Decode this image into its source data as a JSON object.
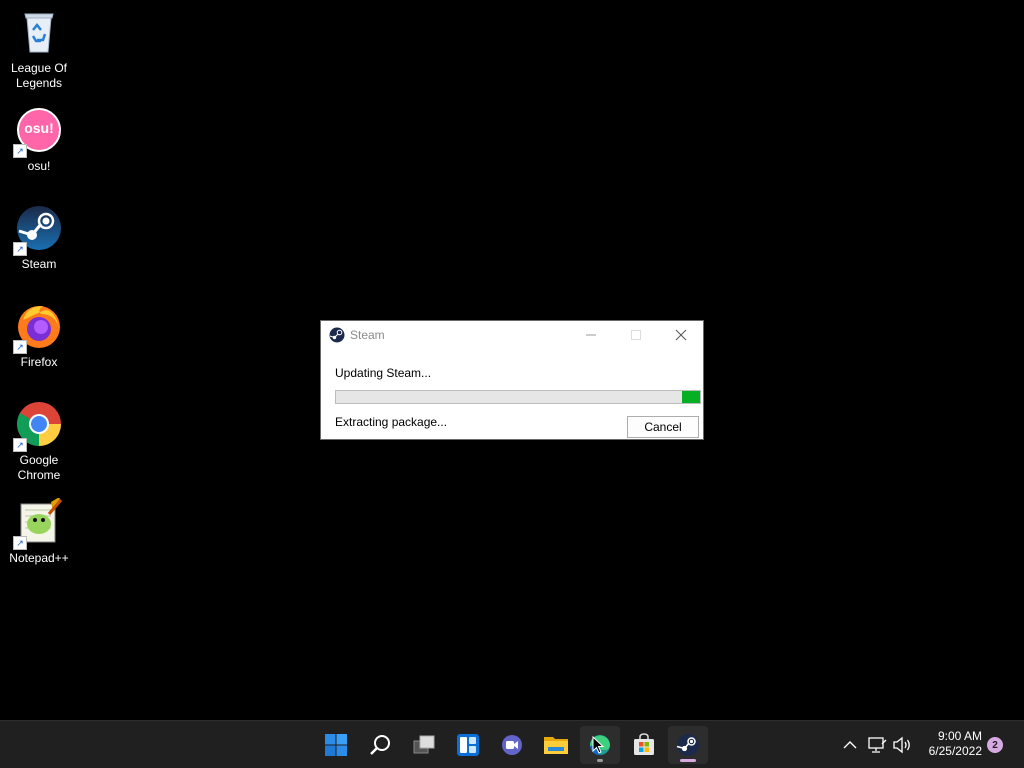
{
  "desktop": {
    "icons": [
      {
        "label": "League Of\nLegends",
        "icon": "recycle-bin-icon",
        "shortcut": false
      },
      {
        "label": "osu!",
        "icon": "osu-icon",
        "shortcut": true,
        "badge_text": "osu!"
      },
      {
        "label": "Steam",
        "icon": "steam-icon",
        "shortcut": true
      },
      {
        "label": "Firefox",
        "icon": "firefox-icon",
        "shortcut": true
      },
      {
        "label": "Google\nChrome",
        "icon": "chrome-icon",
        "shortcut": true
      },
      {
        "label": "Notepad++",
        "icon": "notepadpp-icon",
        "shortcut": true
      }
    ]
  },
  "dialog": {
    "title": "Steam",
    "status": "Updating Steam...",
    "substatus": "Extracting package...",
    "progress_fraction": 0.05,
    "cancel_label": "Cancel",
    "colors": {
      "progress": "#06b025"
    }
  },
  "taskbar": {
    "apps": [
      {
        "name": "start",
        "icon": "windows-start-icon",
        "active": false
      },
      {
        "name": "search",
        "icon": "search-icon",
        "active": false
      },
      {
        "name": "task-view",
        "icon": "task-view-icon",
        "active": false
      },
      {
        "name": "widgets",
        "icon": "widgets-icon",
        "active": false
      },
      {
        "name": "teams-chat",
        "icon": "chat-icon",
        "active": false
      },
      {
        "name": "file-explorer",
        "icon": "folder-icon",
        "active": false
      },
      {
        "name": "edge",
        "icon": "edge-icon",
        "active": true
      },
      {
        "name": "store",
        "icon": "store-icon",
        "active": false
      },
      {
        "name": "steam",
        "icon": "steam-icon",
        "active": true
      }
    ],
    "tray": {
      "time": "9:00 AM",
      "date": "6/25/2022",
      "notification_count": "2"
    }
  }
}
